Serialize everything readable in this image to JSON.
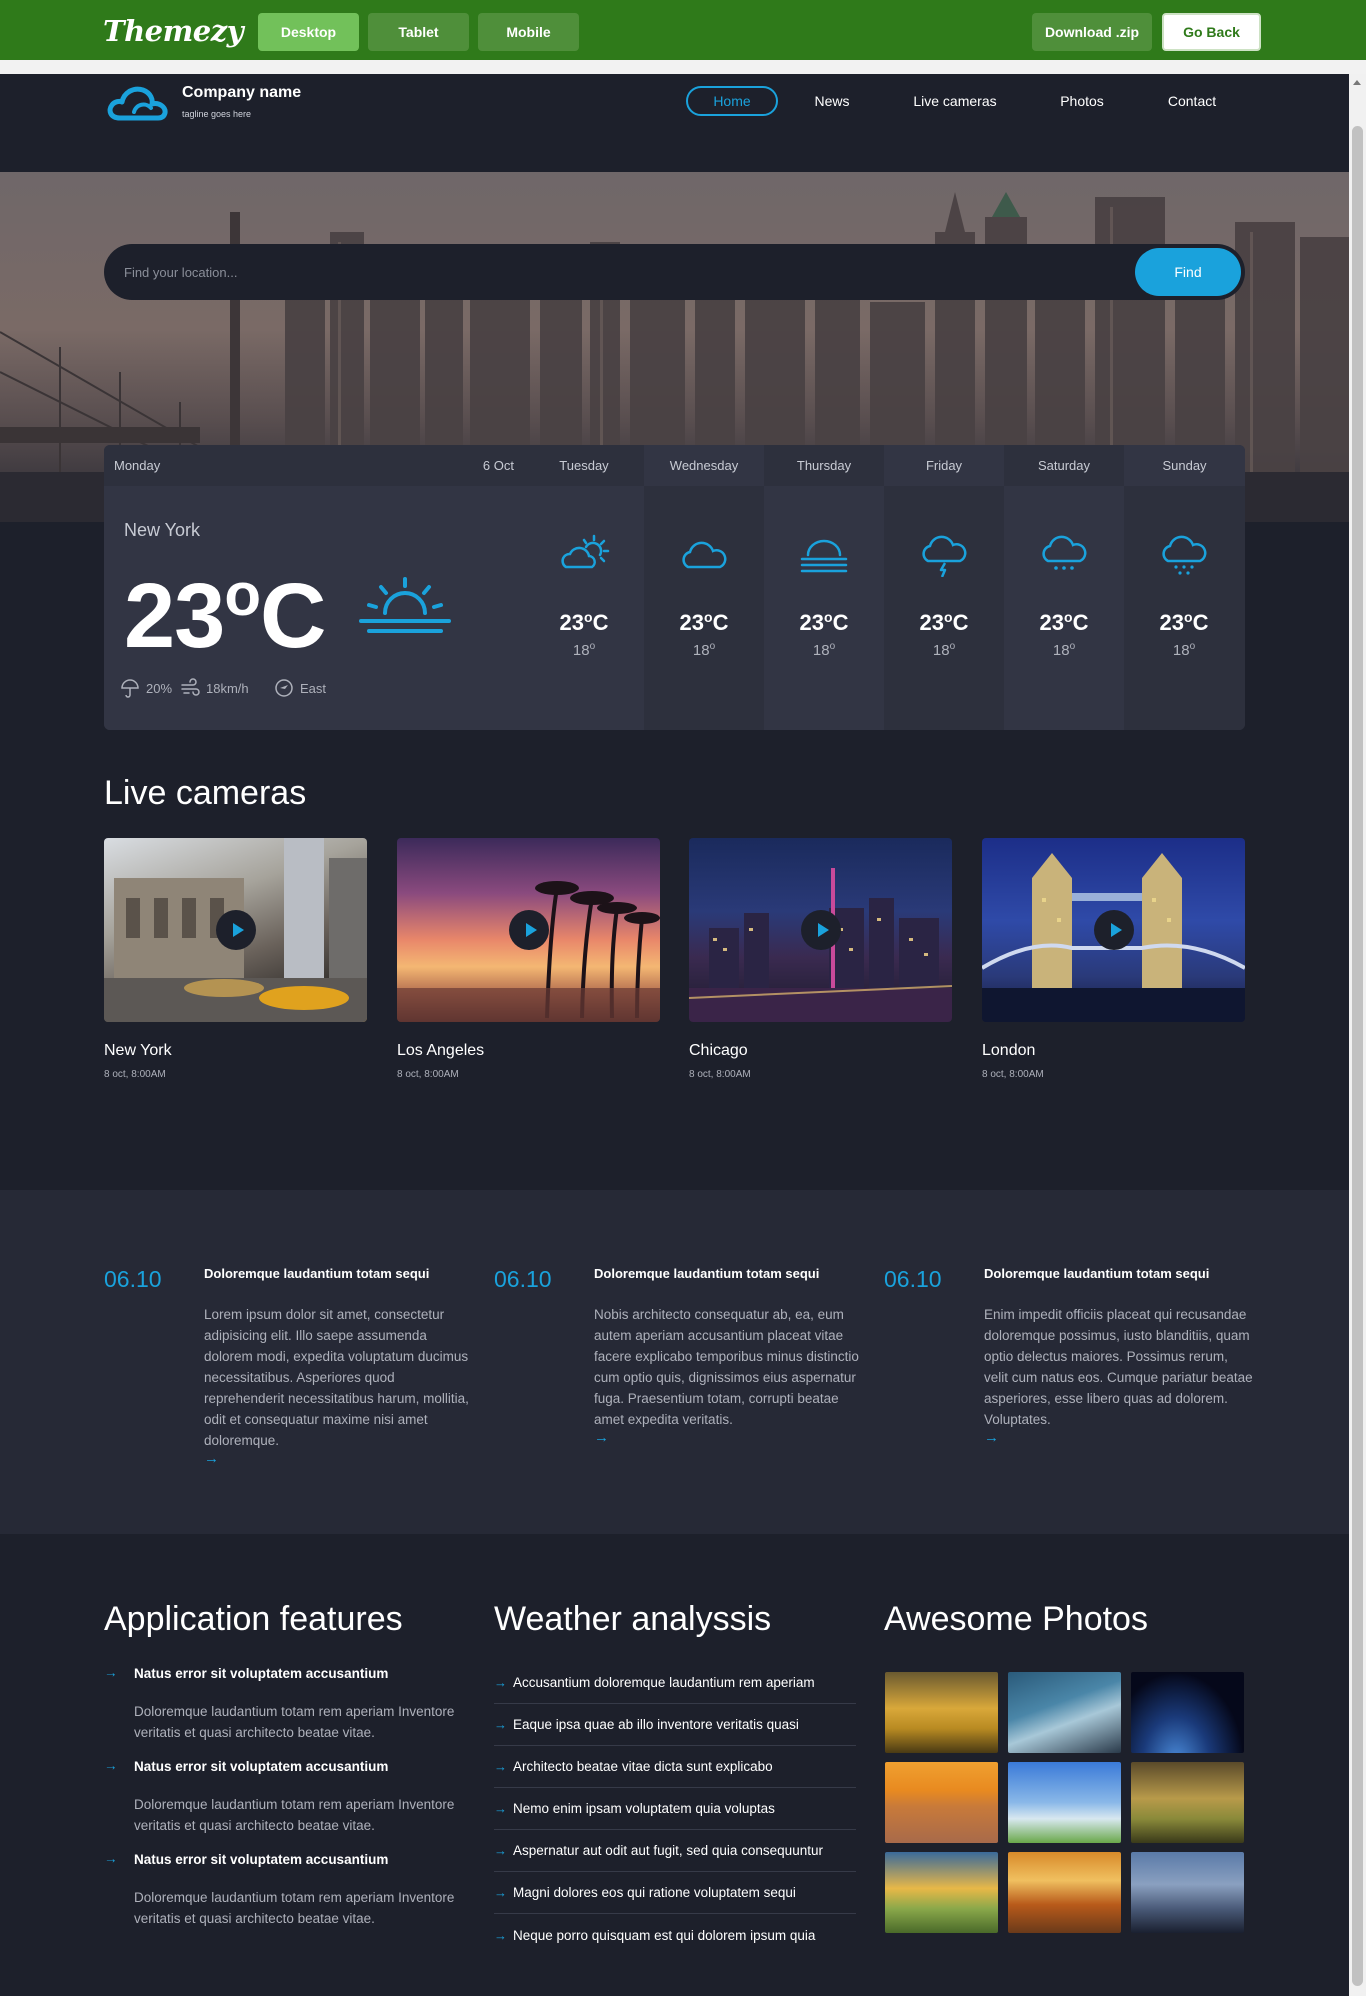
{
  "topbar": {
    "logo": "Themezy",
    "devices": [
      "Desktop",
      "Tablet",
      "Mobile"
    ],
    "download": "Download .zip",
    "go_back": "Go Back"
  },
  "header": {
    "company": "Company name",
    "tagline": "tagline goes here",
    "nav": [
      "Home",
      "News",
      "Live cameras",
      "Photos",
      "Contact"
    ]
  },
  "search": {
    "placeholder": "Find your location...",
    "button": "Find"
  },
  "forecast": {
    "today": {
      "day": "Monday",
      "date": "6 Oct",
      "location": "New York",
      "temp": "23",
      "deg": "o",
      "unit": "C",
      "humidity": "20%",
      "wind": "18km/h",
      "direction": "East"
    },
    "days": [
      {
        "day": "Tuesday",
        "icon": "sun-cloud-icon",
        "temp": "23",
        "low": "18"
      },
      {
        "day": "Wednesday",
        "icon": "cloud-icon",
        "temp": "23",
        "low": "18"
      },
      {
        "day": "Thursday",
        "icon": "fog-icon",
        "temp": "23",
        "low": "18"
      },
      {
        "day": "Friday",
        "icon": "thunder-icon",
        "temp": "23",
        "low": "18"
      },
      {
        "day": "Saturday",
        "icon": "snow-cloud-icon",
        "temp": "23",
        "low": "18"
      },
      {
        "day": "Sunday",
        "icon": "snow-cloud-icon",
        "temp": "23",
        "low": "18"
      }
    ]
  },
  "live_cameras": {
    "title": "Live cameras",
    "items": [
      {
        "city": "New York",
        "time": "8 oct, 8:00AM"
      },
      {
        "city": "Los Angeles",
        "time": "8 oct, 8:00AM"
      },
      {
        "city": "Chicago",
        "time": "8 oct, 8:00AM"
      },
      {
        "city": "London",
        "time": "8 oct, 8:00AM"
      }
    ]
  },
  "news": [
    {
      "date": "06.10",
      "title": "Doloremque laudantium totam sequi",
      "body": "Lorem ipsum dolor sit amet, consectetur adipisicing elit. Illo saepe assumenda dolorem modi, expedita voluptatum ducimus necessitatibus. Asperiores quod reprehenderit necessitatibus harum, mollitia, odit et consequatur maxime nisi amet doloremque.",
      "more": "→"
    },
    {
      "date": "06.10",
      "title": "Doloremque laudantium totam sequi",
      "body": "Nobis architecto consequatur ab, ea, eum autem aperiam accusantium placeat vitae facere explicabo temporibus minus distinctio cum optio quis, dignissimos eius aspernatur fuga. Praesentium totam, corrupti beatae amet expedita veritatis.",
      "more": "→"
    },
    {
      "date": "06.10",
      "title": "Doloremque laudantium totam sequi",
      "body": "Enim impedit officiis placeat qui recusandae doloremque possimus, iusto blanditiis, quam optio delectus maiores. Possimus rerum, velit cum natus eos. Cumque pariatur beatae asperiores, esse libero quas ad dolorem. Voluptates.",
      "more": "→"
    }
  ],
  "features": {
    "title": "Application features",
    "items": [
      {
        "title": "Natus error sit voluptatem accusantium",
        "desc": "Doloremque laudantium totam rem aperiam Inventore veritatis et quasi architecto beatae vitae."
      },
      {
        "title": "Natus error sit voluptatem accusantium",
        "desc": "Doloremque laudantium totam rem aperiam Inventore veritatis et quasi architecto beatae vitae."
      },
      {
        "title": "Natus error sit voluptatem accusantium",
        "desc": "Doloremque laudantium totam rem aperiam Inventore veritatis et quasi architecto beatae vitae."
      }
    ]
  },
  "analysis": {
    "title": "Weather analyssis",
    "items": [
      "Accusantium doloremque laudantium rem aperiam",
      "Eaque ipsa quae ab illo inventore veritatis quasi",
      "Architecto beatae vitae dicta sunt explicabo",
      "Nemo enim ipsam voluptatem quia voluptas",
      "Aspernatur aut odit aut fugit, sed quia consequuntur",
      "Magni dolores eos qui ratione voluptatem sequi",
      "Neque porro quisquam est qui dolorem ipsum quia"
    ]
  },
  "photos": {
    "title": "Awesome Photos"
  },
  "colors": {
    "accent": "#1aa2dc",
    "background": "#1d202b",
    "panel": "#323544",
    "topbar": "#2f7a1a"
  }
}
